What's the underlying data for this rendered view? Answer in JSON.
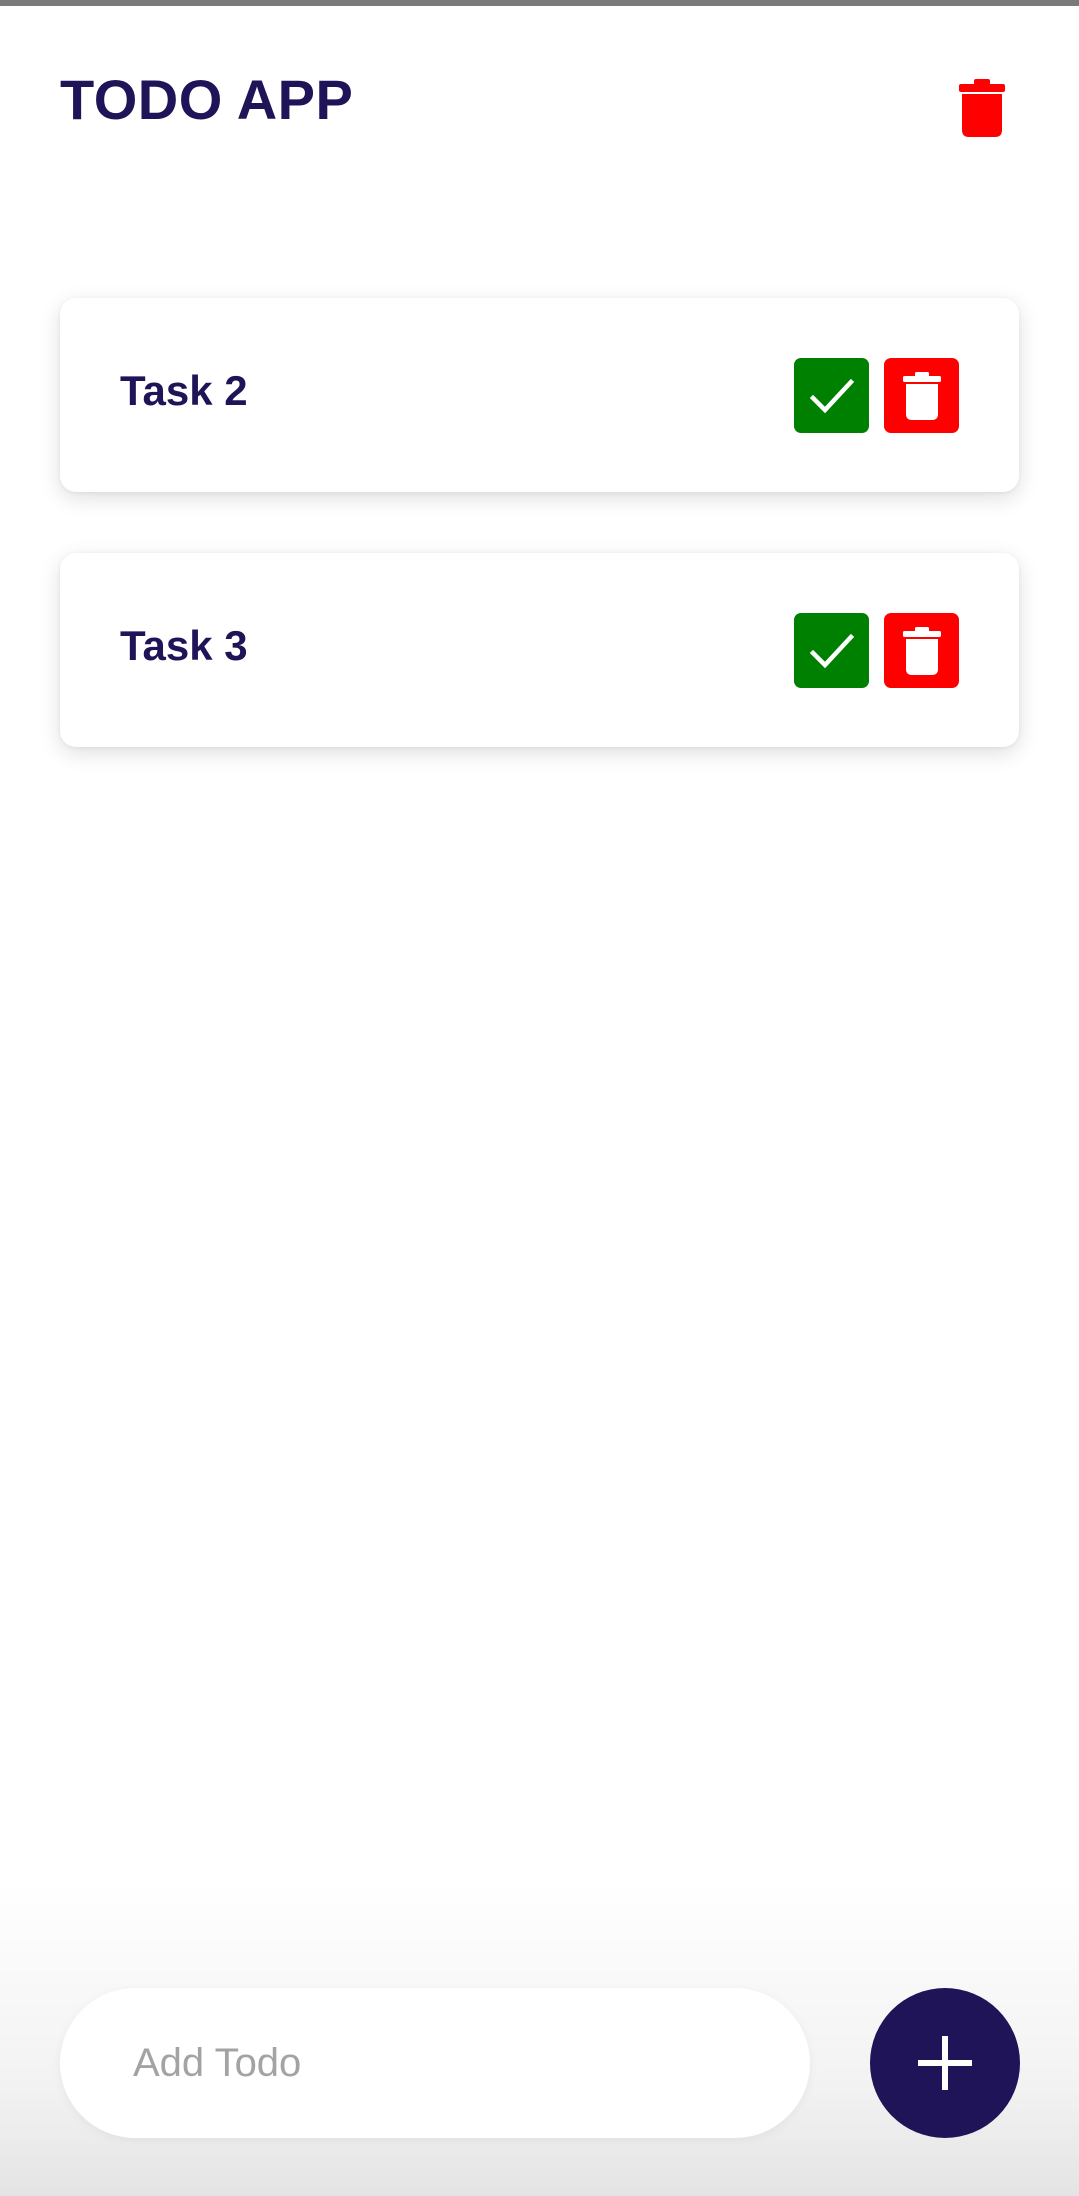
{
  "header": {
    "title": "TODO APP",
    "clear_icon": "trash-icon"
  },
  "todos": [
    {
      "text": "Task 2",
      "complete_icon": "check-icon",
      "delete_icon": "trash-icon"
    },
    {
      "text": "Task 3",
      "complete_icon": "check-icon",
      "delete_icon": "trash-icon"
    }
  ],
  "add_todo": {
    "placeholder": "Add Todo",
    "value": "",
    "button_icon": "plus-icon"
  },
  "colors": {
    "primary": "#1e1457",
    "complete": "#008000",
    "delete": "#ff0000",
    "background": "#ffffff"
  }
}
